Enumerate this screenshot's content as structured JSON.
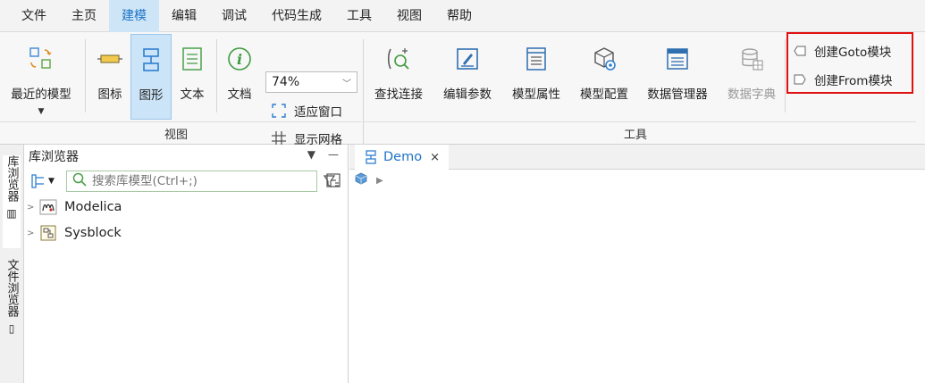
{
  "menu": {
    "items": [
      "文件",
      "主页",
      "建模",
      "编辑",
      "调试",
      "代码生成",
      "工具",
      "视图",
      "帮助"
    ]
  },
  "ribbon": {
    "recent_models": "最近的模型",
    "icon": "图标",
    "diagram": "图形",
    "text": "文本",
    "doc": "文档",
    "zoom": "74%",
    "fit_window": "适应窗口",
    "show_grid": "显示网格",
    "view_group": "视图",
    "find_connection": "查找连接",
    "edit_params": "编辑参数",
    "model_props": "模型属性",
    "model_config": "模型配置",
    "data_manager": "数据管理器",
    "data_dict": "数据字典",
    "tools_group": "工具",
    "create_goto": "创建Goto模块",
    "create_from": "创建From模块"
  },
  "dock": {
    "lib_tab": "库浏览器",
    "file_tab": "文件浏览器"
  },
  "library": {
    "title": "库浏览器",
    "search_placeholder": "搜索库模型(Ctrl+;)",
    "items": [
      "Modelica",
      "Sysblock"
    ]
  },
  "editor": {
    "tab_label": "Demo",
    "close": "×"
  },
  "colors": {
    "accent": "#1f73c7",
    "highlight": "#e01010"
  }
}
